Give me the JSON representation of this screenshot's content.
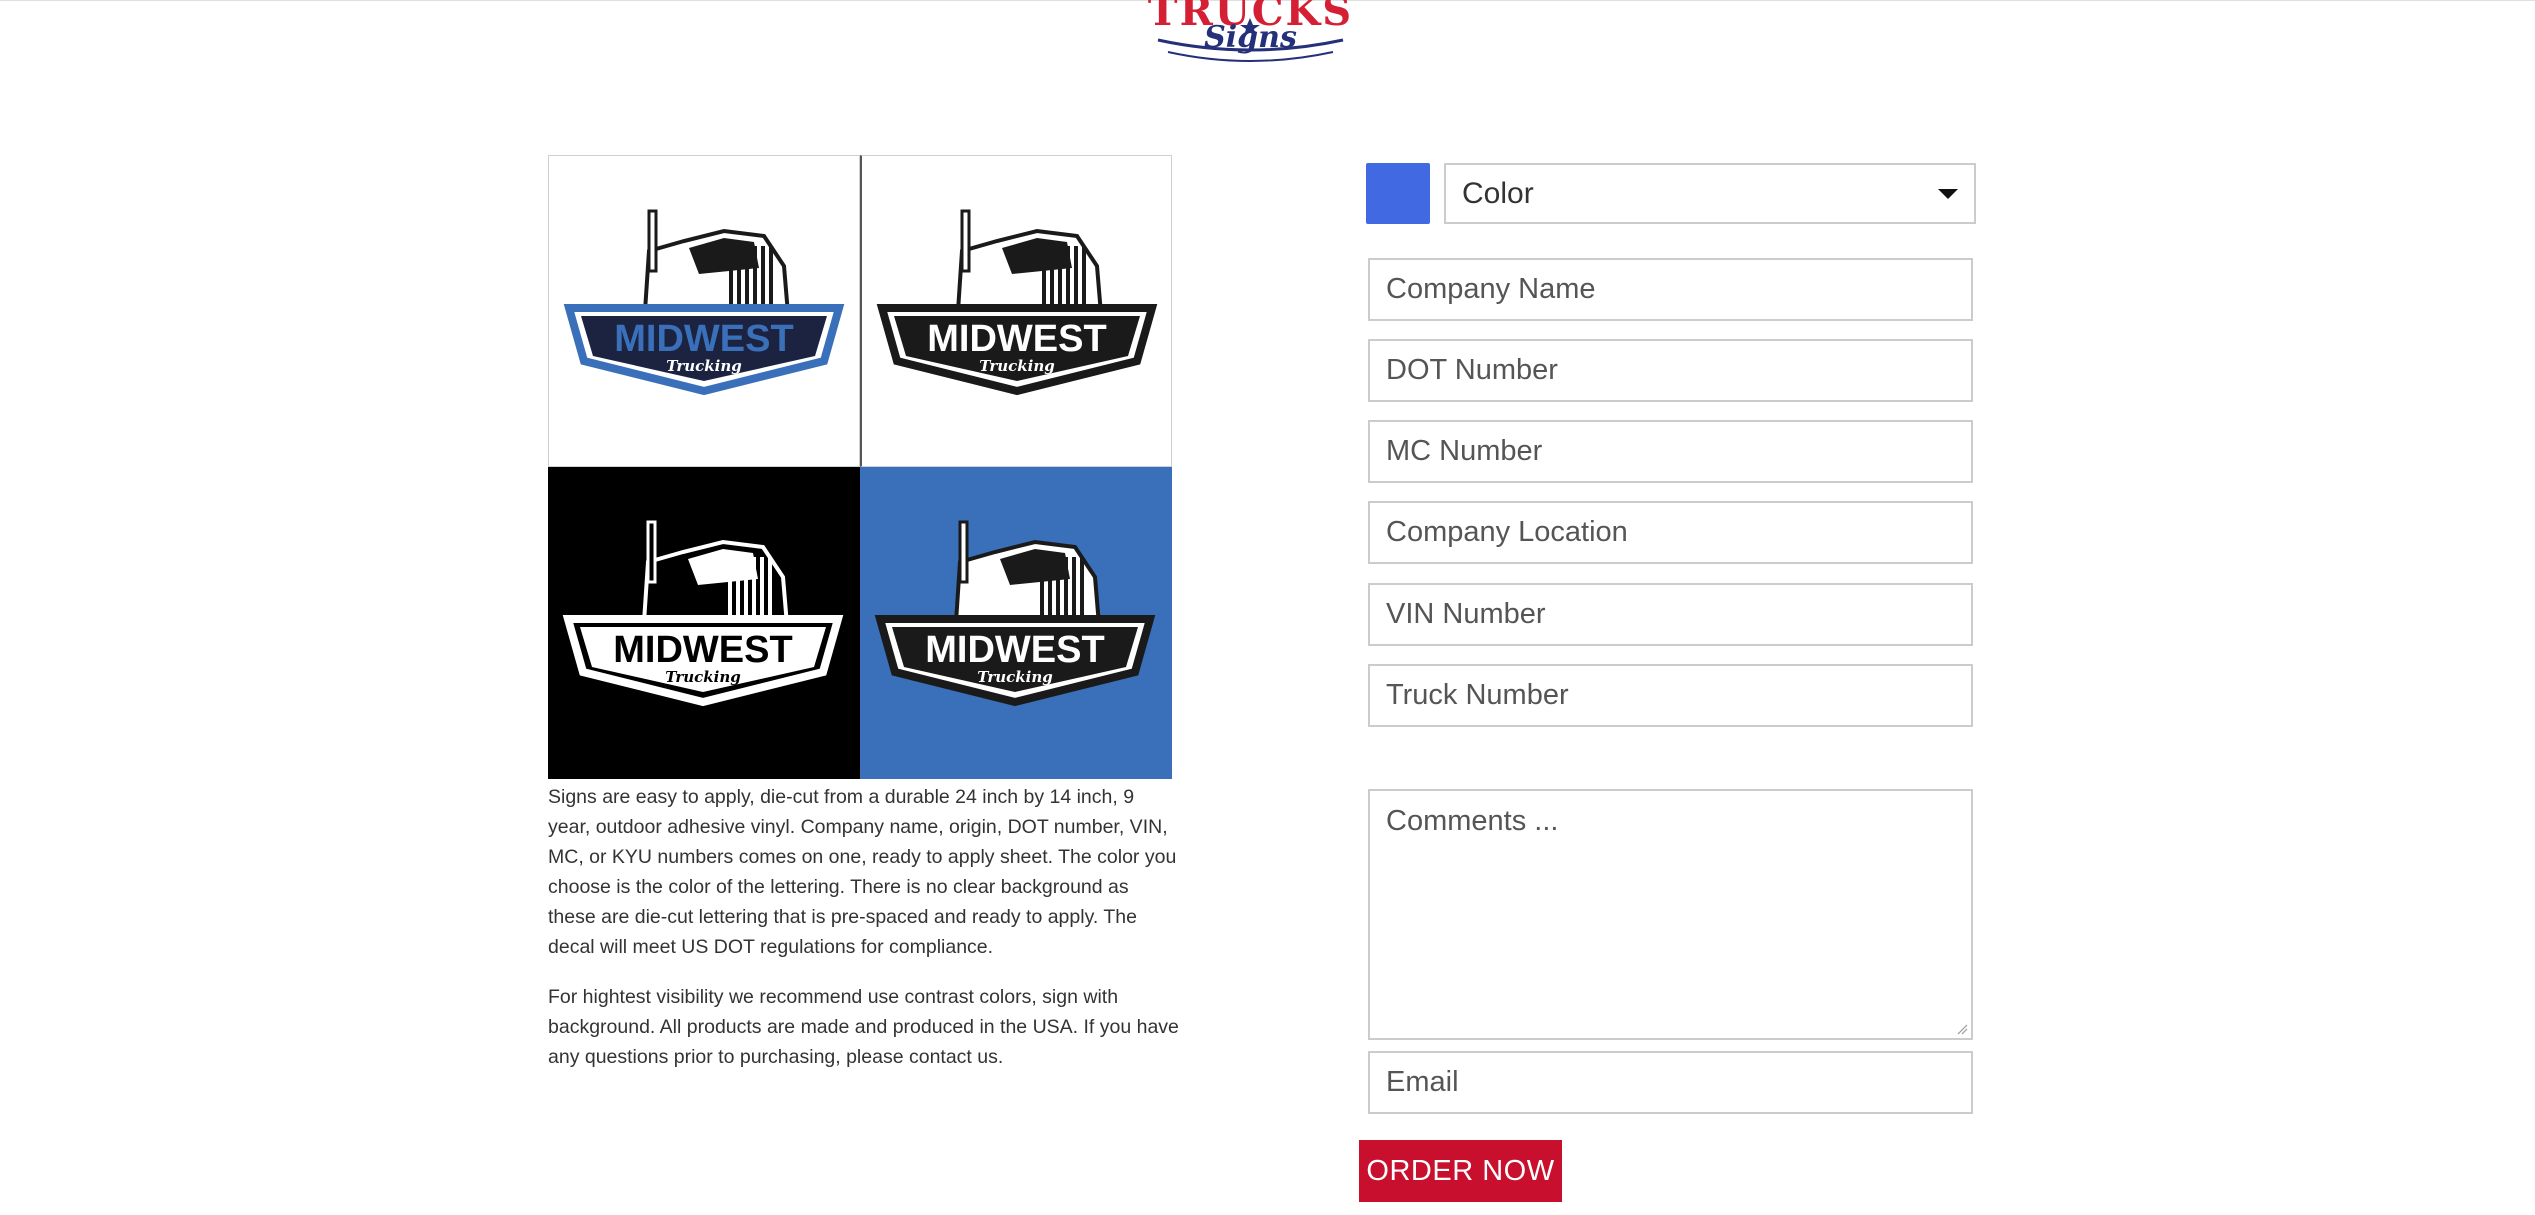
{
  "header": {
    "logo_line1": "TRUCKS",
    "logo_line2": "Signs"
  },
  "gallery": {
    "tiles": [
      {
        "background": "#ffffff",
        "lettering": "#3a70b9",
        "brand": "MIDWEST",
        "sub": "Trucking"
      },
      {
        "background": "#ffffff",
        "lettering": "#1a1a1a",
        "brand": "MIDWEST",
        "sub": "Trucking"
      },
      {
        "background": "#000000",
        "lettering": "#ffffff",
        "brand": "MIDWEST",
        "sub": "Trucking"
      },
      {
        "background": "#3a70b9",
        "lettering": "#1a1a1a",
        "brand": "MIDWEST",
        "sub": "Trucking"
      }
    ]
  },
  "description": {
    "p1": "Signs are easy to apply, die-cut from a durable 24 inch by 14 inch, 9 year, outdoor adhesive vinyl. Company name, origin, DOT number, VIN, MC, or KYU numbers comes on one, ready to apply sheet. The color you choose is the color of the lettering. There is no clear background as these are die-cut lettering that is pre-spaced and ready to apply. The decal will meet US DOT regulations for compliance.",
    "p2": "For hightest visibility we recommend use contrast colors, sign with background. All products are made and produced in the USA. If you have any questions prior to purchasing, please contact us."
  },
  "form": {
    "swatch_color": "#4169e1",
    "color_select": "Color",
    "company_name": "Company Name",
    "dot_number": "DOT Number",
    "mc_number": "MC Number",
    "company_location": "Company Location",
    "vin_number": "VIN Number",
    "truck_number": "Truck Number",
    "comments": "Comments ...",
    "email": "Email",
    "order_button": "ORDER NOW",
    "order_color": "#c8102e"
  }
}
